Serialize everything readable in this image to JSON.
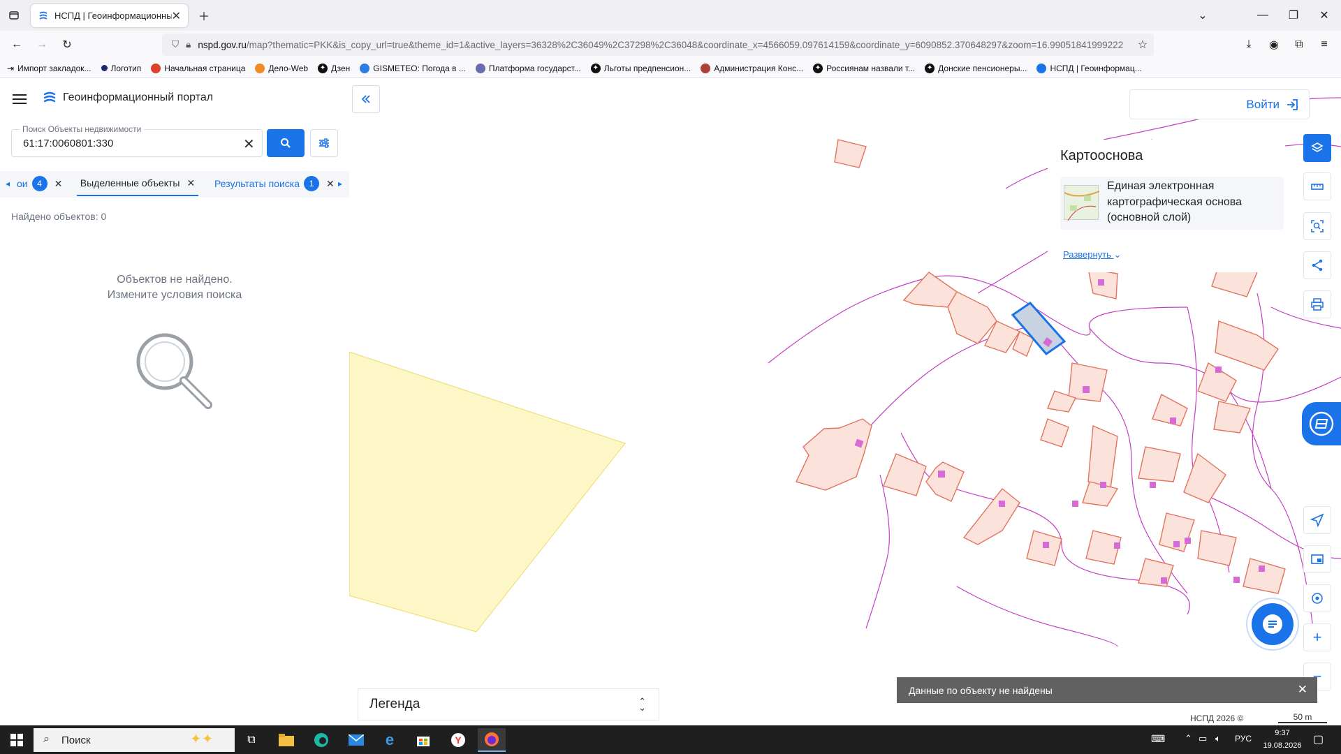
{
  "browser": {
    "tab_title": "НСПД | Геоинформационный",
    "url_host": "nspd.gov.ru",
    "url_rest": "/map?thematic=PKK&is_copy_url=true&theme_id=1&active_layers=36328%2C36049%2C37298%2C36048&coordinate_x=4566059.097614159&coordinate_y=6090852.370648297&zoom=16.99051841999222",
    "bookmarks": [
      "Импорт закладок...",
      "Логотип",
      "Начальная страница",
      "Дело-Web",
      "Дзен",
      "GISMETEO: Погода в ...",
      "Платформа государст...",
      "Льготы предпенсион...",
      "Администрация Конс...",
      "Россиянам назвали т...",
      "Донские пенсионеры...",
      "НСПД | Геоинформац..."
    ]
  },
  "header": {
    "title": "Геоинформационный портал"
  },
  "search": {
    "label": "Поиск Объекты недвижимости",
    "value": "61:17:0060801:330"
  },
  "tabs": [
    {
      "label": "ои",
      "count": "4"
    },
    {
      "label": "Выделенные объекты"
    },
    {
      "label": "Результаты поиска",
      "count": "1"
    }
  ],
  "results": {
    "found": "Найдено объектов: 0",
    "empty_line1": "Объектов не найдено.",
    "empty_line2": "Измените условия поиска"
  },
  "map": {
    "login": "Войти",
    "basemap_title": "Картооснова",
    "basemap_name_line1": "Единая электронная",
    "basemap_name_line2": "картографическая основа",
    "basemap_name_line3": "(основной слой)",
    "expand": "Развернуть",
    "legend": "Легенда",
    "toast": "Данные по объекту не найдены",
    "copyright": "НСПД 2026 ©",
    "scale": "50 m"
  },
  "taskbar": {
    "search_placeholder": "Поиск",
    "lang": "РУС",
    "time": "9:37",
    "date": "19.08.2026"
  },
  "colors": {
    "accent": "#1a73e8",
    "parcel_fill": "#fbe3dc",
    "parcel_stroke": "#e2735e",
    "building": "#d86ad8",
    "road_line": "#c43fc3",
    "zone_fill": "#fdf7c8",
    "selected_fill": "#c9d2e0"
  }
}
